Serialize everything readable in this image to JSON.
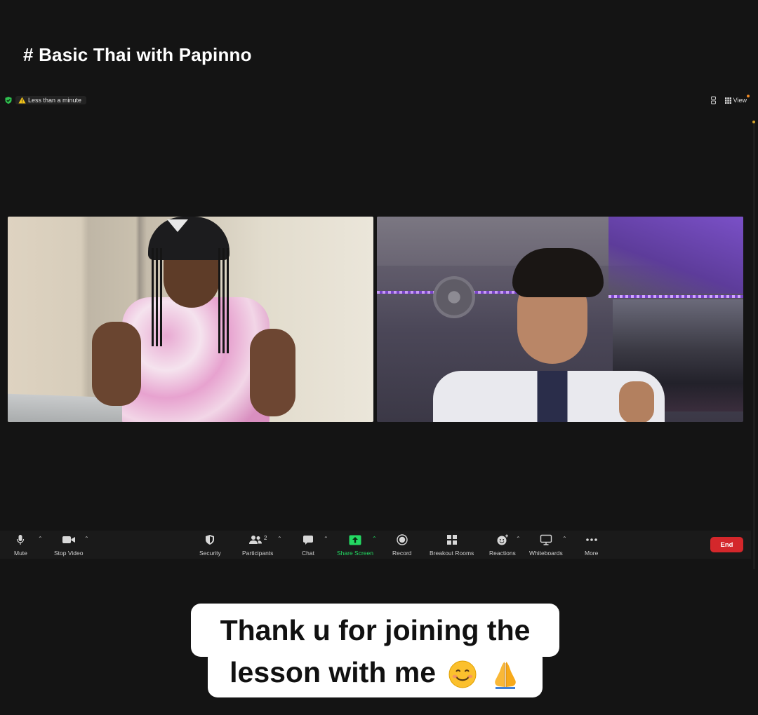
{
  "meeting": {
    "title": "# Basic Thai with Papinno",
    "timer_text": "Less than a minute",
    "view_label": "View"
  },
  "toolbar": {
    "items": [
      {
        "label": "Mute",
        "icon": "microphone-icon"
      },
      {
        "label": "Stop Video",
        "icon": "video-camera-icon"
      },
      {
        "label": "Security",
        "icon": "shield-icon"
      },
      {
        "label": "Participants",
        "icon": "participants-icon",
        "count": "2"
      },
      {
        "label": "Chat",
        "icon": "chat-icon"
      },
      {
        "label": "Share Screen",
        "icon": "share-screen-icon"
      },
      {
        "label": "Record",
        "icon": "record-icon"
      },
      {
        "label": "Breakout Rooms",
        "icon": "breakout-rooms-icon"
      },
      {
        "label": "Reactions",
        "icon": "reactions-icon"
      },
      {
        "label": "Whiteboards",
        "icon": "whiteboard-icon"
      },
      {
        "label": "More",
        "icon": "more-icon"
      }
    ],
    "end_label": "End"
  },
  "caption": {
    "line1": "Thank u for joining the",
    "line2": "lesson with me"
  },
  "colors": {
    "background": "#141414",
    "toolbar": "#1a1a1a",
    "share_green": "#23d962",
    "end_red": "#d4272b"
  }
}
